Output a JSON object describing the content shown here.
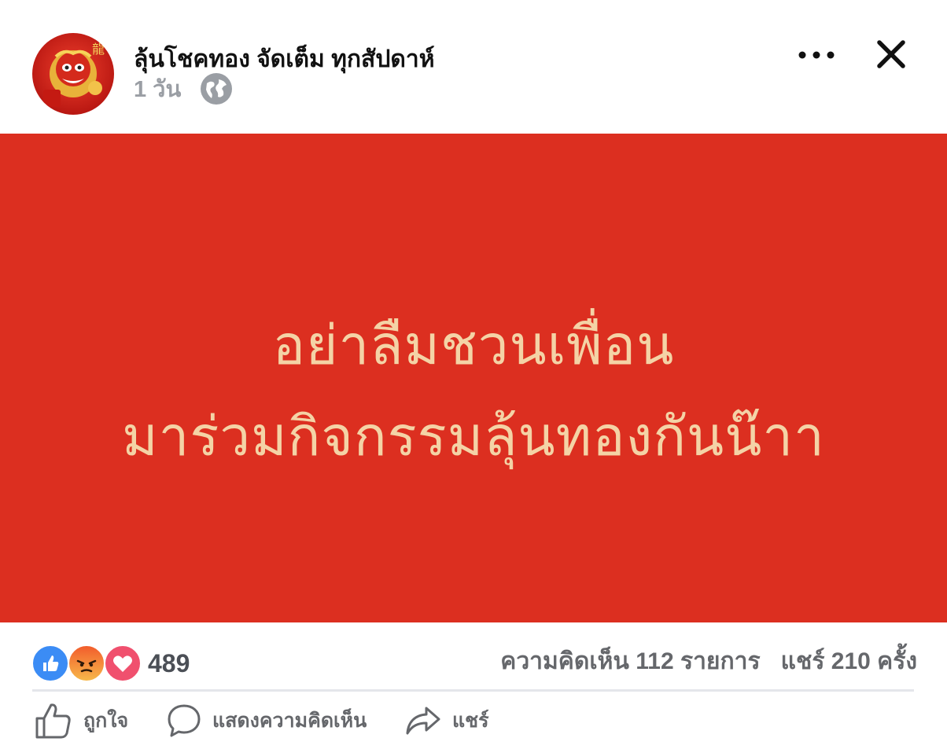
{
  "post": {
    "page_name": "ลุ้นโชคทอง จัดเต็ม ทุกสัปดาห์",
    "time": "1 วัน",
    "privacy_icon": "globe-icon"
  },
  "header": {
    "more_icon": "more-options-icon",
    "close_icon": "close-icon"
  },
  "image": {
    "background_color": "#dc2f20",
    "text_color": "#f4d3a6",
    "lines": [
      "อย่าลืมชวนเพื่อน",
      "มาร่วมกิจกรรมลุ้นทองกันน๊าา"
    ]
  },
  "reactions": {
    "icons": [
      "like-icon",
      "angry-icon",
      "love-icon"
    ],
    "count": "489"
  },
  "stats": {
    "comments": "ความคิดเห็น 112 รายการ",
    "shares": "แชร์ 210 ครั้ง"
  },
  "actions": {
    "like_label": "ถูกใจ",
    "comment_label": "แสดงความคิดเห็น",
    "share_label": "แชร์"
  }
}
